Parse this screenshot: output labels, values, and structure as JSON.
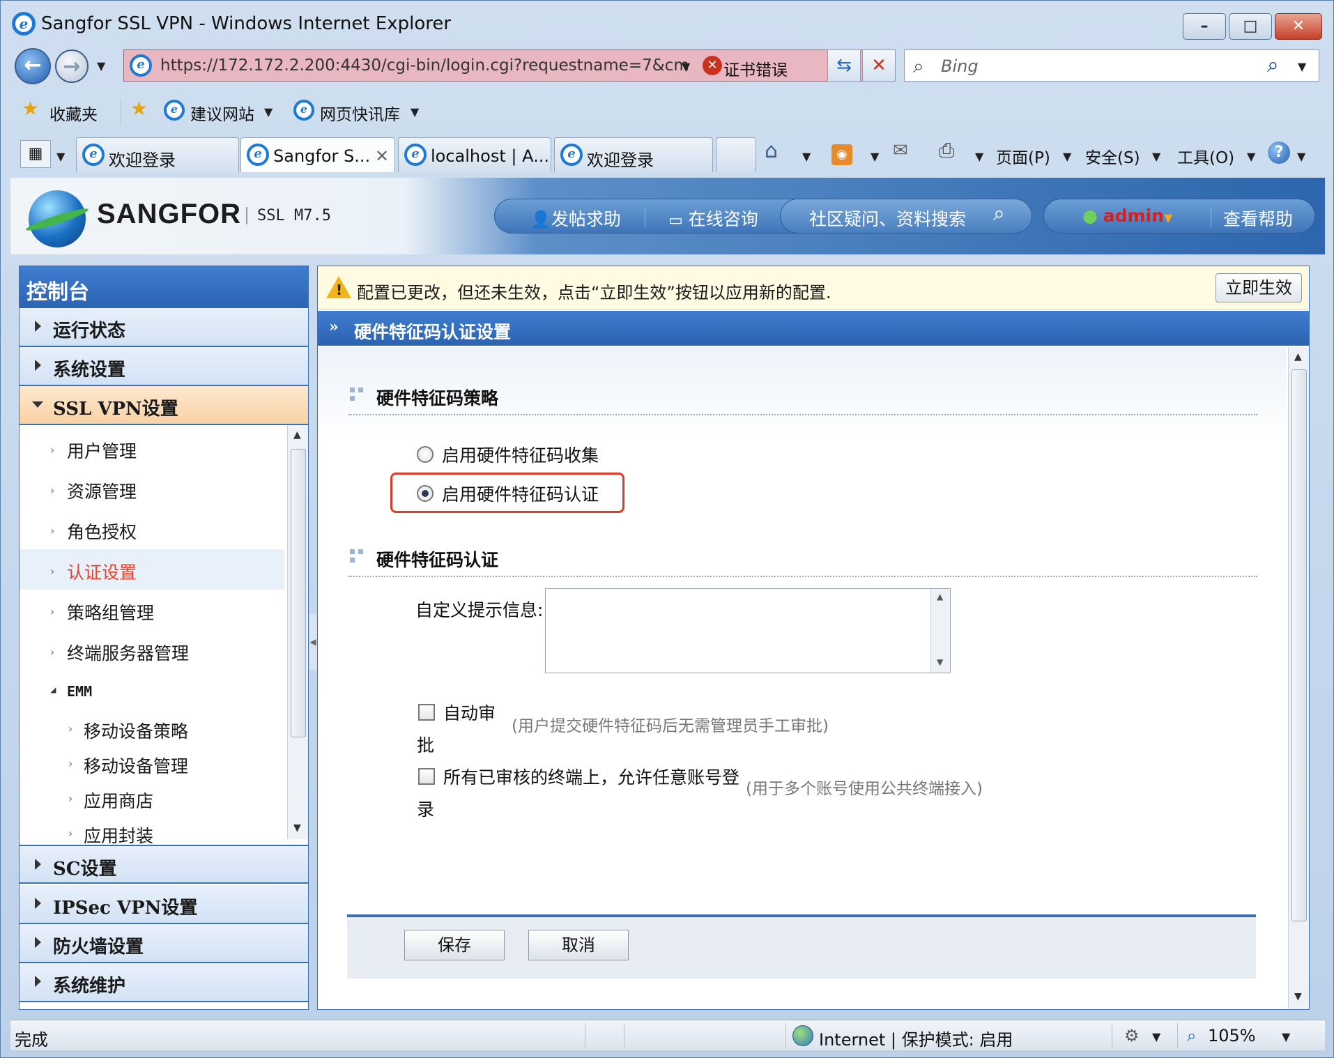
{
  "window": {
    "title": "Sangfor SSL VPN - Windows Internet Explorer",
    "minimize": "–",
    "maximize": "□",
    "close": "✕"
  },
  "addressbar": {
    "url": "https://172.172.2.200:4430/cgi-bin/login.cgi?requestname=7&cm",
    "cert_error": "证书错误",
    "search_placeholder": "Bing"
  },
  "favbar": {
    "favorites": "收藏夹",
    "suggested": "建议网站",
    "webslice": "网页快讯库"
  },
  "tabs": [
    {
      "label": "欢迎登录"
    },
    {
      "label": "Sangfor S...",
      "close": "✕"
    },
    {
      "label": "localhost | A..."
    },
    {
      "label": "欢迎登录"
    }
  ],
  "commandbar": {
    "page": "页面(P)",
    "safety": "安全(S)",
    "tools": "工具(O)"
  },
  "header": {
    "brand": "SANGFOR",
    "version": "SSL M7.5",
    "post_help": "发帖求助",
    "online_consult": "在线咨询",
    "search_label": "社区疑问、资料搜索",
    "user": "admin",
    "view_help": "查看帮助"
  },
  "sidebar": {
    "title": "控制台",
    "top_items": [
      {
        "label": "运行状态"
      },
      {
        "label": "系统设置"
      },
      {
        "label": "SSL VPN设置"
      }
    ],
    "sub_items": [
      {
        "label": "用户管理"
      },
      {
        "label": "资源管理"
      },
      {
        "label": "角色授权"
      },
      {
        "label": "认证设置"
      },
      {
        "label": "策略组管理"
      },
      {
        "label": "终端服务器管理"
      }
    ],
    "emm": {
      "label": "EMM"
    },
    "emm_items": [
      {
        "label": "移动设备策略"
      },
      {
        "label": "移动设备管理"
      },
      {
        "label": "应用商店"
      },
      {
        "label": "应用封装"
      }
    ],
    "bottom_items": [
      {
        "label": "SC设置"
      },
      {
        "label": "IPSec VPN设置"
      },
      {
        "label": "防火墙设置"
      },
      {
        "label": "系统维护"
      }
    ]
  },
  "main": {
    "notice": "配置已更改，但还未生效，点击“立即生效”按钮以应用新的配置.",
    "apply_now": "立即生效",
    "title": "硬件特征码认证设置",
    "section1": "硬件特征码策略",
    "radio_collect": "启用硬件特征码收集",
    "radio_auth": "启用硬件特征码认证",
    "radio_selected": "auth",
    "section2": "硬件特征码认证",
    "custom_prompt_label": "自定义提示信息:",
    "custom_prompt_value": "",
    "auto_approve_line1": "自动审",
    "auto_approve_line2": "批",
    "auto_approve_hint": "(用户提交硬件特征码后无需管理员手工审批)",
    "any_account_line1": "所有已审核的终端上，允许任意账号登",
    "any_account_line2": "录",
    "any_account_hint": "(用于多个账号使用公共终端接入)",
    "save": "保存",
    "cancel": "取消"
  },
  "statusbar": {
    "left": "完成",
    "zone": "Internet | 保护模式: 启用",
    "zoom": "105%"
  },
  "colors": {
    "accent_blue": "#2c63b2",
    "selected_red": "#e5412b",
    "highlight_box": "#e23a2a",
    "admin_red": "#e21b1b"
  }
}
